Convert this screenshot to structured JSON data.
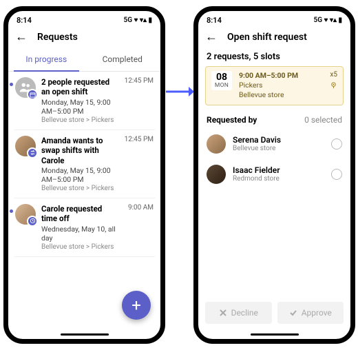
{
  "status": {
    "time": "8:14",
    "net": "5G"
  },
  "left": {
    "title": "Requests",
    "tabs": {
      "active": "In progress",
      "inactive": "Completed"
    },
    "items": [
      {
        "title": "2 people requested an open shift",
        "subtitle": "Monday, May 15, 9:00 AM–5:00 PM",
        "location": "Bellevue store > Pickers",
        "time": "12:45 PM",
        "avatar": "group",
        "badge": "calendar",
        "dot": true
      },
      {
        "title": "Amanda wants to swap shifts with Carole",
        "subtitle": "Monday, May 15, 9:00 AM–5:00 PM",
        "location": "Bellevue store > Pickers",
        "time": "12:45 PM",
        "avatar": "photo",
        "badge": "swap",
        "dot": false
      },
      {
        "title": "Carole requested time off",
        "subtitle": "Wednesday, May 10, all day",
        "location": "Bellevue store > Pickers",
        "time": "9:00 AM",
        "avatar": "photo2",
        "badge": "timeoff",
        "dot": true
      }
    ]
  },
  "right": {
    "title": "Open shift request",
    "summary": "2 requests, 5 slots",
    "shift": {
      "dateNum": "08",
      "dateDay": "MON",
      "time": "9:00 AM–5:00 PM",
      "role": "Pickers",
      "store": "Bellevue store",
      "multiplier": "x5"
    },
    "section": {
      "label": "Requested by",
      "selected": "0 selected"
    },
    "requesters": [
      {
        "name": "Serena Davis",
        "store": "Bellevue store"
      },
      {
        "name": "Isaac Fielder",
        "store": "Redmond store"
      }
    ],
    "buttons": {
      "decline": "Decline",
      "approve": "Approve"
    }
  }
}
